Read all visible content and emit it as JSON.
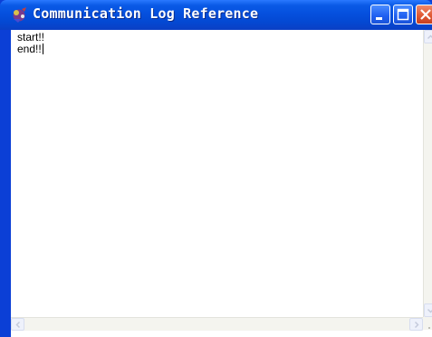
{
  "window": {
    "title": "Communication Log Reference",
    "icon": "app-logo-icon",
    "controls": [
      "minimize-icon",
      "maximize-icon",
      "close-icon"
    ]
  },
  "log": {
    "lines": [
      "start!!",
      "end!!"
    ]
  },
  "scrollbars": {
    "vertical": {
      "up": "chevron-up-icon",
      "down": "chevron-down-icon"
    },
    "horizontal": {
      "left": "chevron-left-icon",
      "right": "chevron-right-icon"
    }
  },
  "colors": {
    "titlebar": "#0550de",
    "close_button": "#e05a35",
    "title_text": "#ffffff"
  }
}
